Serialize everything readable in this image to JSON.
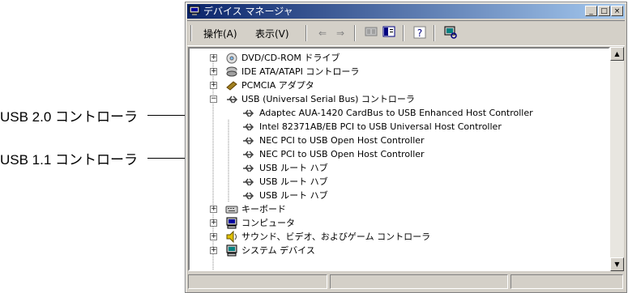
{
  "annotations": {
    "usb20": "USB 2.0 コントローラ",
    "usb11": "USB 1.1 コントローラ"
  },
  "window": {
    "title": "デバイス マネージャ",
    "minimize": "_",
    "maximize": "□",
    "close": "×"
  },
  "menu": {
    "action": "操作(A)",
    "view": "表示(V)"
  },
  "toolbar": {
    "back_icon": "arrow-left-icon",
    "forward_icon": "arrow-right-icon",
    "properties_icon": "properties-icon",
    "view_icon": "view-icon",
    "help_icon": "help-icon",
    "scan_icon": "scan-hardware-icon"
  },
  "tree": {
    "nodes": [
      {
        "label": "DVD/CD-ROM ドライブ",
        "icon": "cdrom-icon",
        "expanded": false
      },
      {
        "label": "IDE ATA/ATAPI コントローラ",
        "icon": "ide-controller-icon",
        "expanded": false
      },
      {
        "label": "PCMCIA アダプタ",
        "icon": "pcmcia-icon",
        "expanded": false
      },
      {
        "label": "USB (Universal Serial Bus) コントローラ",
        "icon": "usb-icon",
        "expanded": true
      },
      {
        "label": "Adaptec AUA-1420 CardBus to USB Enhanced Host Controller",
        "icon": "usb-icon"
      },
      {
        "label": "Intel 82371AB/EB PCI to USB Universal Host Controller",
        "icon": "usb-icon"
      },
      {
        "label": "NEC PCI to USB Open Host Controller",
        "icon": "usb-icon"
      },
      {
        "label": "NEC PCI to USB Open Host Controller",
        "icon": "usb-icon"
      },
      {
        "label": "USB ルート ハブ",
        "icon": "usb-icon"
      },
      {
        "label": "USB ルート ハブ",
        "icon": "usb-icon"
      },
      {
        "label": "USB ルート ハブ",
        "icon": "usb-icon"
      },
      {
        "label": "キーボード",
        "icon": "keyboard-icon",
        "expanded": false
      },
      {
        "label": "コンピュータ",
        "icon": "computer-icon",
        "expanded": false
      },
      {
        "label": "サウンド、ビデオ、およびゲーム コントローラ",
        "icon": "sound-icon",
        "expanded": false
      },
      {
        "label": "システム デバイス",
        "icon": "system-device-icon",
        "expanded": false
      }
    ]
  },
  "scrollbar": {
    "up": "▲",
    "down": "▼"
  }
}
